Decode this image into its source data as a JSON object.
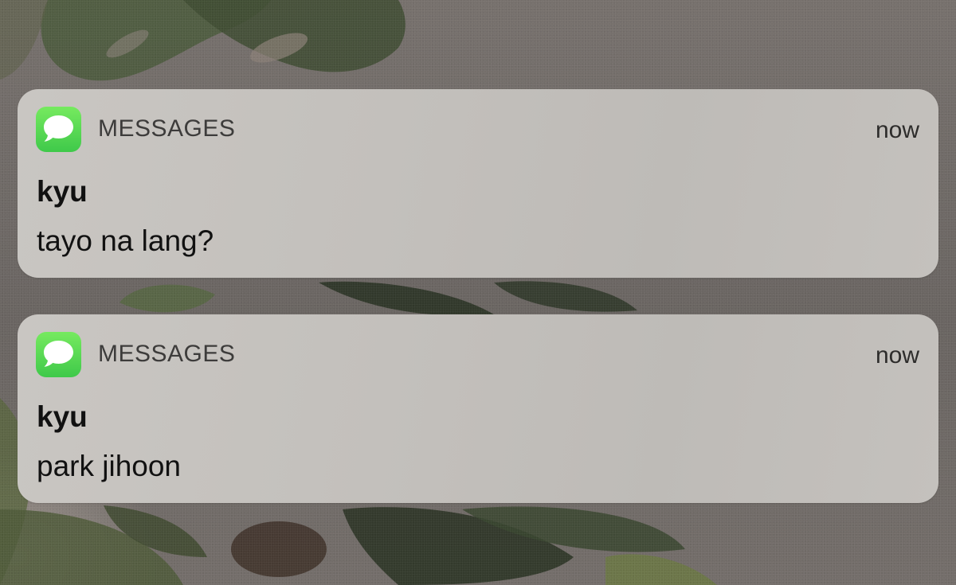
{
  "notifications": [
    {
      "app_name": "MESSAGES",
      "time": "now",
      "sender": "kyu",
      "message": "tayo na lang?",
      "icon": "messages-app-icon"
    },
    {
      "app_name": "MESSAGES",
      "time": "now",
      "sender": "kyu",
      "message": "park jihoon",
      "icon": "messages-app-icon"
    }
  ],
  "colors": {
    "app_icon_green": "#4cd964",
    "card_background": "#c4c1bd",
    "text_primary": "#111111",
    "text_secondary": "#3d3c3b"
  }
}
